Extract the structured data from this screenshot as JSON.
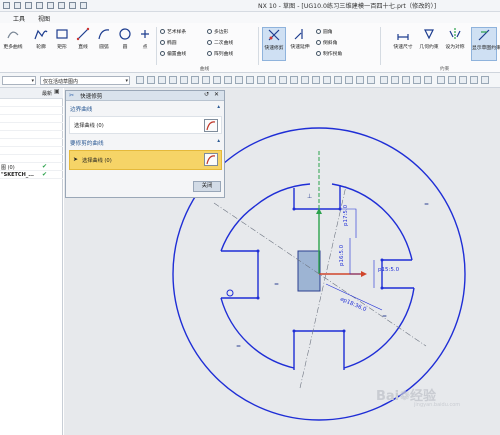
{
  "window": {
    "title": "NX 10 - 草图 - [UG10.0练习三维建模一百四十七.prt（修改的）]"
  },
  "menu": [
    "工具",
    "视图"
  ],
  "ribbon": {
    "left_label": "更多曲线",
    "buttons": [
      "轮廓",
      "矩形",
      "直线",
      "圆弧",
      "圆",
      "点"
    ],
    "small_left": [
      "艺术样条",
      "椭圆",
      "偏置曲线"
    ],
    "small_right": [
      "多边形",
      "二次曲线",
      "阵列曲线"
    ],
    "group_label": "曲线",
    "trim_buttons": [
      "快速修剪",
      "快速延伸"
    ],
    "small_corner": [
      "圆角",
      "倒斜角",
      "制作拐角"
    ],
    "right_buttons": [
      "快速尺寸",
      "几何约束",
      "设为对称",
      "显示草图约束"
    ],
    "constraint_group": "约束"
  },
  "toolbar": {
    "filter_value": "",
    "select_value": "仅在活动草图内"
  },
  "left_panel": {
    "header_col": "最新",
    "rows": [
      {
        "label": "图 (0)",
        "check": "✔"
      },
      {
        "label": "\"SKETCH_...",
        "check": "✔"
      }
    ]
  },
  "dialog": {
    "title": "快速修剪",
    "section1": {
      "header": "边界曲线",
      "label": "选择曲线 (0)"
    },
    "section2": {
      "header": "要修剪的曲线",
      "label": "选择曲线 (0)"
    },
    "close_label": "关闭"
  },
  "sketch": {
    "dim1": "p17:5.0",
    "dim2": "p15:5.0",
    "dim3": "p16:5.0",
    "dim4": "⌀p18:36.0",
    "equal_marks": [
      "=",
      "=",
      "=",
      "="
    ]
  },
  "watermark": {
    "text": "Bai❁经验",
    "sub": "jingyan.baidu.com"
  },
  "colors": {
    "sketch_blue": "#1f2ed6",
    "highlight": "#f6d467",
    "dialog_header": "#2d5b95"
  }
}
